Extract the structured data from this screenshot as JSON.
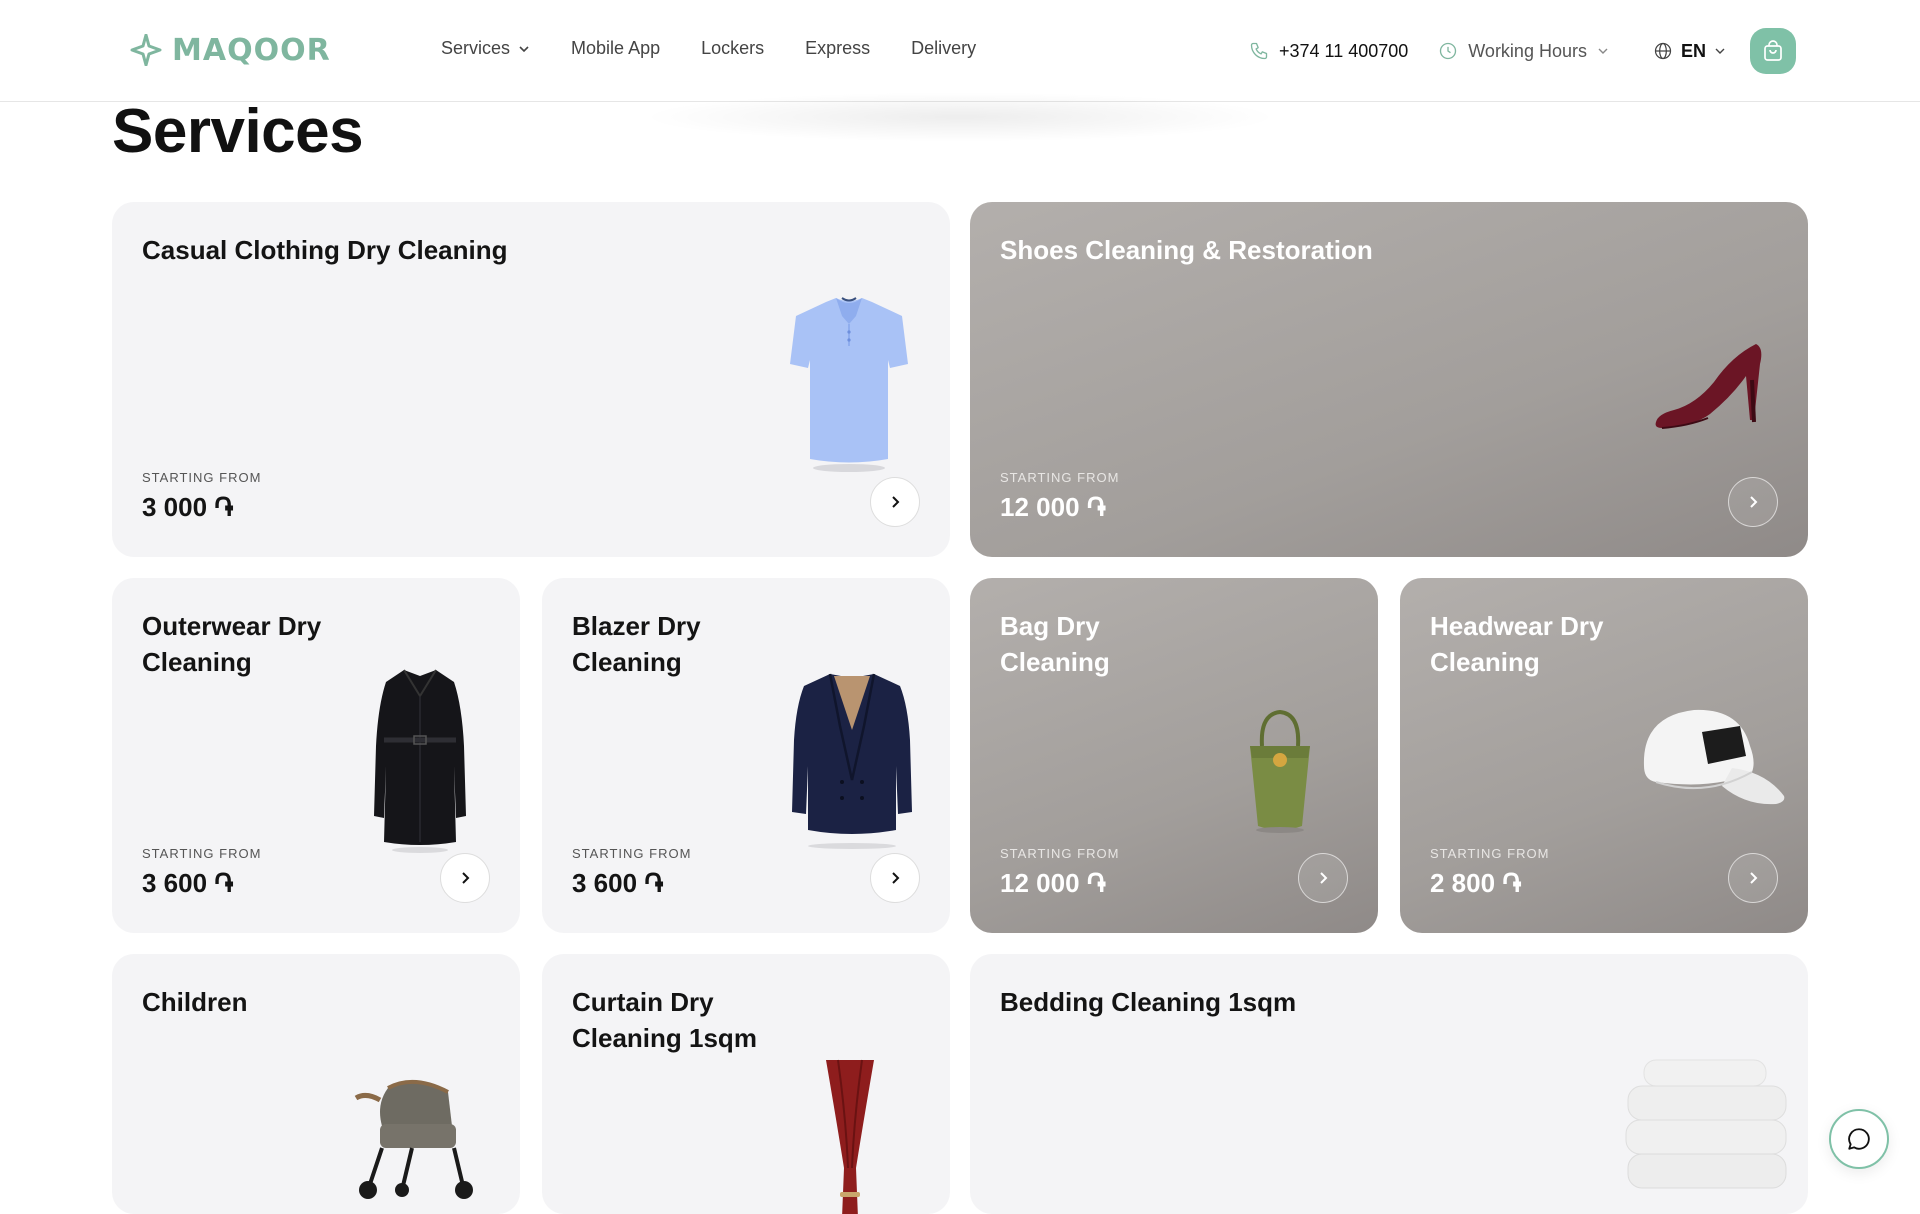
{
  "header": {
    "brand": "MAQOOR",
    "nav": [
      {
        "label": "Services",
        "dropdown": true
      },
      {
        "label": "Mobile App",
        "dropdown": false
      },
      {
        "label": "Lockers",
        "dropdown": false
      },
      {
        "label": "Express",
        "dropdown": false
      },
      {
        "label": "Delivery",
        "dropdown": false
      }
    ],
    "phone": "+374 11 400700",
    "working_hours": "Working Hours",
    "language": "EN"
  },
  "page": {
    "title": "Services"
  },
  "services": [
    {
      "title": "Casual Clothing Dry Cleaning",
      "label": "STARTING FROM",
      "price": "3 000 ֏",
      "icon": "polo-shirt-icon"
    },
    {
      "title": "Shoes Cleaning & Restoration",
      "label": "STARTING FROM",
      "price": "12 000 ֏",
      "icon": "high-heel-shoe-icon"
    },
    {
      "title": "Outerwear Dry Cleaning",
      "label": "STARTING FROM",
      "price": "3 600 ֏",
      "icon": "coat-icon"
    },
    {
      "title": "Blazer Dry Cleaning",
      "label": "STARTING FROM",
      "price": "3 600 ֏",
      "icon": "blazer-icon"
    },
    {
      "title": "Bag Dry Cleaning",
      "label": "STARTING FROM",
      "price": "12 000 ֏",
      "icon": "bag-icon"
    },
    {
      "title": "Headwear Dry Cleaning",
      "label": "STARTING FROM",
      "price": "2 800 ֏",
      "icon": "cap-icon"
    },
    {
      "title": "Children",
      "icon": "stroller-icon"
    },
    {
      "title": "Curtain Dry Cleaning 1sqm",
      "icon": "curtain-icon"
    },
    {
      "title": "Bedding Cleaning 1sqm",
      "icon": "towels-icon"
    }
  ],
  "colors": {
    "brand": "#7fb69f",
    "cart": "#7fc1a7",
    "card_light": "#f4f4f6",
    "card_dark": "#a5a19e"
  }
}
